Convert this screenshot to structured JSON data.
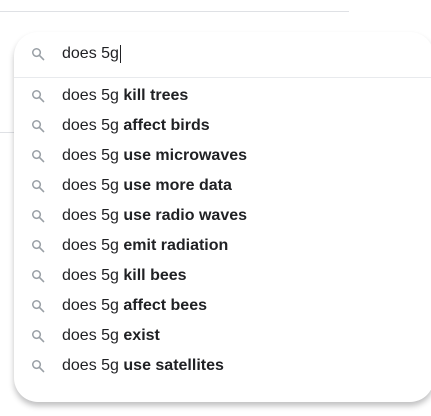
{
  "search": {
    "query": "does 5g",
    "icon": "search-icon"
  },
  "suggestions": [
    {
      "prefix": "does 5g ",
      "completion": "kill trees"
    },
    {
      "prefix": "does 5g ",
      "completion": "affect birds"
    },
    {
      "prefix": "does 5g ",
      "completion": "use microwaves"
    },
    {
      "prefix": "does 5g ",
      "completion": "use more data"
    },
    {
      "prefix": "does 5g ",
      "completion": "use radio waves"
    },
    {
      "prefix": "does 5g ",
      "completion": "emit radiation"
    },
    {
      "prefix": "does 5g ",
      "completion": "kill bees"
    },
    {
      "prefix": "does 5g ",
      "completion": "affect bees"
    },
    {
      "prefix": "does 5g ",
      "completion": "exist"
    },
    {
      "prefix": "does 5g ",
      "completion": "use satellites"
    }
  ],
  "colors": {
    "icon": "#9aa0a6",
    "text": "#202124",
    "divider": "#e8eaed"
  }
}
